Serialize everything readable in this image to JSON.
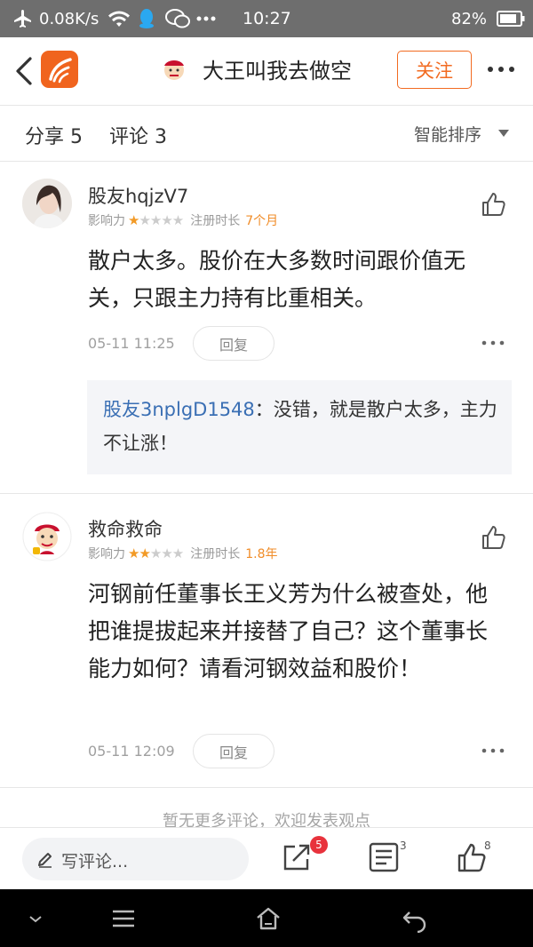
{
  "status_bar": {
    "speed": "0.08K/s",
    "time": "10:27",
    "battery": "82%"
  },
  "nav": {
    "title": "大王叫我去做空",
    "follow_label": "关注"
  },
  "tabs": {
    "share": "分享 5",
    "comment": "评论 3",
    "sort": "智能排序"
  },
  "comments": [
    {
      "user": "股友hqjzV7",
      "influence_label": "影响力",
      "stars_filled": 1,
      "stars_total": 5,
      "reg_label": "注册时长",
      "reg_value": "7个月",
      "body": "散户太多。股价在大多数时间跟价值无关，只跟主力持有比重相关。",
      "time": "05-11 11:25",
      "reply_label": "回复",
      "reply": {
        "user": "股友3nplgD1548",
        "separator": "：",
        "text": "没错，就是散户太多，主力不让涨！"
      }
    },
    {
      "user": "救命救命",
      "influence_label": "影响力",
      "stars_filled": 2,
      "stars_total": 5,
      "reg_label": "注册时长",
      "reg_value": "1.8年",
      "body": "河钢前任董事长王义芳为什么被查处，他把谁提拔起来并接替了自己？这个董事长能力如何？请看河钢效益和股价！",
      "time": "05-11 12:09",
      "reply_label": "回复"
    }
  ],
  "no_more_text": "暂无更多评论，欢迎发表观点",
  "toolbar": {
    "write_placeholder": "写评论...",
    "share_badge": "5",
    "list_count": "3",
    "like_count": "8"
  },
  "colors": {
    "accent": "#f26b21",
    "star": "#f29a26",
    "link": "#3a6fb4",
    "badge": "#e8323c",
    "statusbar": "#6e6e6e"
  },
  "icons": [
    "airplane-icon",
    "wifi-icon",
    "qq-icon",
    "wechat-icon",
    "battery-icon",
    "back-icon",
    "app-logo",
    "more-icon",
    "like-icon",
    "edit-icon",
    "share-icon",
    "list-icon",
    "menu-icon",
    "home-icon",
    "system-back-icon"
  ]
}
